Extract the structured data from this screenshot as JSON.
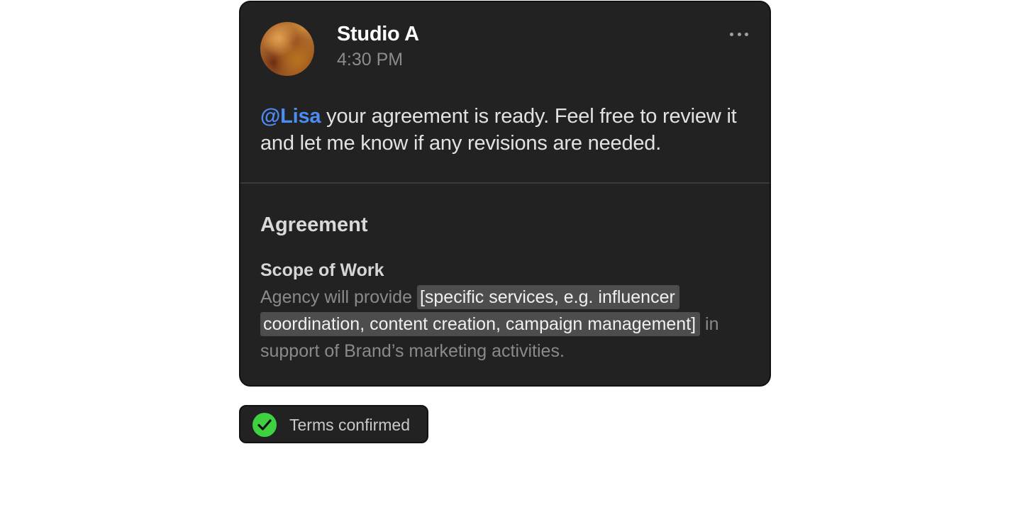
{
  "post": {
    "sender": "Studio A",
    "time": "4:30 PM",
    "mention": "@Lisa",
    "message": " your agreement is ready. Feel free to review it and let me know if any revisions are needed."
  },
  "agreement": {
    "title": "Agreement",
    "section_heading": "Scope of Work",
    "text_before": "Agency will provide ",
    "placeholder": "[specific services, e.g. influencer coordination, content creation, campaign management]",
    "text_after": " in support of Brand’s marketing activities."
  },
  "status": {
    "label": "Terms confirmed",
    "icon": "check-circle-icon",
    "color": "#3fd13f"
  },
  "colors": {
    "card_background": "#222222",
    "mention": "#4b8cf5",
    "placeholder_highlight": "#4d4d4d"
  }
}
